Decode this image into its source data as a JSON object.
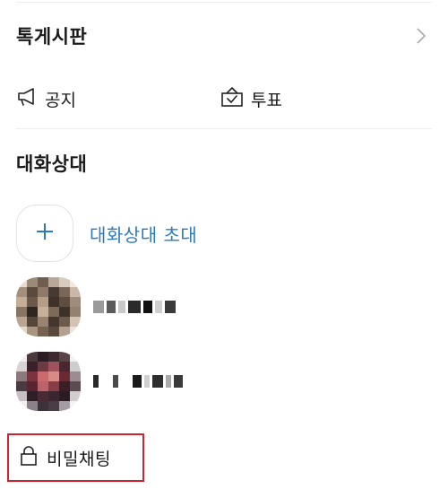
{
  "board": {
    "title": "톡게시판",
    "notice_label": "공지",
    "vote_label": "투표"
  },
  "partners": {
    "title": "대화상대",
    "invite_label": "대화상대 초대",
    "members": [
      {
        "name_hidden": true,
        "avatar_hidden": true
      },
      {
        "name_hidden": true,
        "avatar_hidden": true
      }
    ]
  },
  "secret_chat": {
    "label": "비밀채팅",
    "highlight_color": "#d0232f"
  },
  "colors": {
    "accent_link": "#2b7bc0",
    "divider": "#ededed"
  },
  "icons": {
    "board_chevron": "chevron-right-icon",
    "notice": "megaphone-icon",
    "vote": "ballot-box-icon",
    "invite": "plus-icon",
    "secret": "lock-icon"
  }
}
